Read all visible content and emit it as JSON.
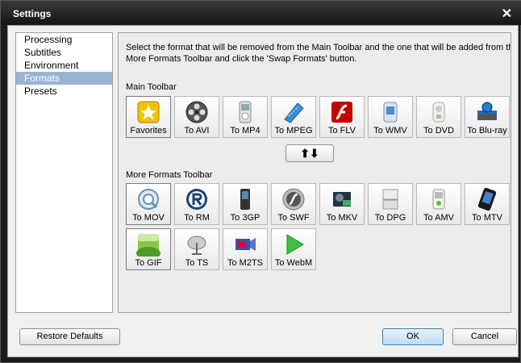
{
  "window": {
    "title": "Settings",
    "close_glyph": "✕"
  },
  "sidebar": {
    "items": [
      {
        "label": "Processing",
        "selected": false
      },
      {
        "label": "Subtitles",
        "selected": false
      },
      {
        "label": "Environment",
        "selected": false
      },
      {
        "label": "Formats",
        "selected": true
      },
      {
        "label": "Presets",
        "selected": false
      }
    ]
  },
  "panel": {
    "description": "Select the format that will be removed from the Main Toolbar and the one that will be added from the\nMore Formats Toolbar and click the 'Swap Formats' button.",
    "main_toolbar_label": "Main Toolbar",
    "more_toolbar_label": "More Formats Toolbar",
    "swap_glyph": "⬆⬇",
    "main_buttons": [
      {
        "label": "Favorites",
        "icon": "star-icon"
      },
      {
        "label": "To AVI",
        "icon": "film-reel-icon"
      },
      {
        "label": "To MP4",
        "icon": "ipod-icon"
      },
      {
        "label": "To MPEG",
        "icon": "film-strip-icon"
      },
      {
        "label": "To FLV",
        "icon": "flash-icon"
      },
      {
        "label": "To WMV",
        "icon": "windows-media-icon"
      },
      {
        "label": "To DVD",
        "icon": "dvd-player-icon"
      },
      {
        "label": "To Blu-ray",
        "icon": "blu-ray-icon"
      }
    ],
    "more_buttons_row1": [
      {
        "label": "To MOV",
        "icon": "quicktime-icon"
      },
      {
        "label": "To RM",
        "icon": "realmedia-icon"
      },
      {
        "label": "To 3GP",
        "icon": "mobile-phone-icon"
      },
      {
        "label": "To SWF",
        "icon": "flash-disc-icon"
      },
      {
        "label": "To MKV",
        "icon": "mkv-film-icon"
      },
      {
        "label": "To DPG",
        "icon": "nintendo-ds-icon"
      },
      {
        "label": "To AMV",
        "icon": "mp3-player-icon"
      },
      {
        "label": "To MTV",
        "icon": "media-player-icon"
      }
    ],
    "more_buttons_row2": [
      {
        "label": "To GIF",
        "icon": "landscape-image-icon"
      },
      {
        "label": "To TS",
        "icon": "satellite-dish-icon"
      },
      {
        "label": "To M2TS",
        "icon": "camcorder-icon"
      },
      {
        "label": "To WebM",
        "icon": "play-triangle-icon"
      }
    ]
  },
  "footer": {
    "restore_label": "Restore Defaults",
    "ok_label": "OK",
    "cancel_label": "Cancel"
  }
}
